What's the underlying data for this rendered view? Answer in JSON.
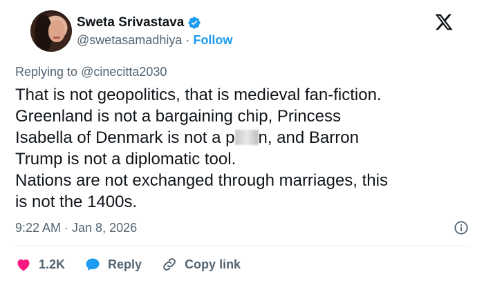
{
  "author": {
    "display_name": "Sweta Srivastava",
    "handle": "@swetasamadhiya",
    "separator": "·",
    "follow_label": "Follow"
  },
  "reply": {
    "prefix": "Replying to ",
    "mention": "@cinecitta2030"
  },
  "tweet": {
    "line1": "That is not geopolitics, that is medieval fan-fiction.",
    "line2": "Greenland is not a bargaining chip, Princess",
    "line3_before": "Isabella of Denmark is not a p",
    "line3_after": "n, and Barron",
    "line4": "Trump is not a diplomatic tool.",
    "line5": "Nations are not exchanged through marriages, this",
    "line6": "is not the 1400s."
  },
  "meta": {
    "timestamp": "9:22 AM · Jan 8, 2026"
  },
  "actions": {
    "likes": "1.2K",
    "reply_label": "Reply",
    "copy_link_label": "Copy link"
  },
  "colors": {
    "accent": "#1d9bf0",
    "like": "#f91880",
    "text": "#0f1419",
    "muted": "#536471"
  }
}
